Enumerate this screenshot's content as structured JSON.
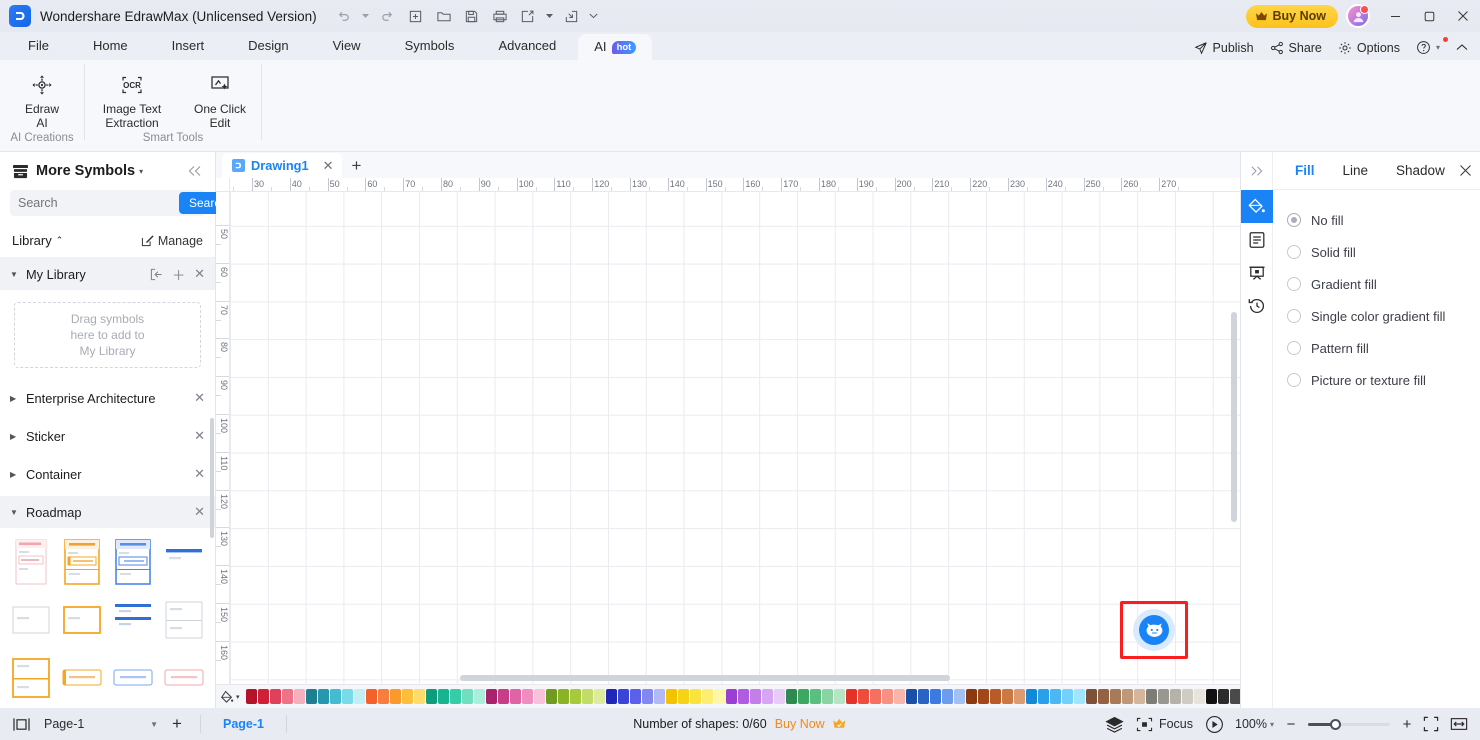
{
  "titlebar": {
    "app_title": "Wondershare EdrawMax (Unlicensed Version)",
    "logo_glyph": "Ɔ",
    "quick_access": [
      {
        "name": "undo-button",
        "glyph": "↶"
      },
      {
        "name": "undo-dropdown",
        "glyph": "▾"
      },
      {
        "name": "redo-button",
        "glyph": "↷"
      },
      {
        "name": "new-button",
        "glyph": "＋"
      },
      {
        "name": "open-button",
        "glyph": "🗀"
      },
      {
        "name": "save-button",
        "glyph": "🖫"
      },
      {
        "name": "print-button",
        "glyph": "🖨"
      },
      {
        "name": "export-button",
        "glyph": "↗"
      },
      {
        "name": "export-dropdown",
        "glyph": "▾"
      },
      {
        "name": "share-quick-button",
        "glyph": "⤵"
      },
      {
        "name": "qat-more-button",
        "glyph": "⌄"
      }
    ],
    "buy_now": "Buy Now",
    "window_controls": [
      {
        "name": "minimize-button",
        "glyph": "—"
      },
      {
        "name": "maximize-button",
        "glyph": "☐"
      },
      {
        "name": "close-button",
        "glyph": "✕"
      }
    ]
  },
  "menubar": {
    "items": [
      {
        "label": "File",
        "name": "menu-file"
      },
      {
        "label": "Home",
        "name": "menu-home"
      },
      {
        "label": "Insert",
        "name": "menu-insert"
      },
      {
        "label": "Design",
        "name": "menu-design"
      },
      {
        "label": "View",
        "name": "menu-view"
      },
      {
        "label": "Symbols",
        "name": "menu-symbols"
      },
      {
        "label": "Advanced",
        "name": "menu-advanced"
      }
    ],
    "active_tab": {
      "label": "AI",
      "badge": "hot"
    },
    "right_items": [
      {
        "label": "Publish",
        "name": "publish-button"
      },
      {
        "label": "Share",
        "name": "share-button"
      },
      {
        "label": "Options",
        "name": "options-button"
      }
    ],
    "help_glyph": "?",
    "collapse_glyph": "⌃"
  },
  "ribbon": {
    "groups": [
      {
        "label": "AI Creations",
        "name": "ribbon-group-ai-creations",
        "buttons": [
          {
            "label": "Edraw\nAI",
            "line1": "Edraw",
            "line2": "AI",
            "name": "edraw-ai-button",
            "icon": "ai-move-icon"
          }
        ]
      },
      {
        "label": "Smart Tools",
        "name": "ribbon-group-smart-tools",
        "buttons": [
          {
            "line1": "Image Text",
            "line2": "Extraction",
            "name": "image-text-extraction-button",
            "icon": "ocr-icon"
          },
          {
            "line1": "One Click",
            "line2": "Edit",
            "name": "one-click-edit-button",
            "icon": "magic-edit-icon"
          }
        ]
      }
    ]
  },
  "left_panel": {
    "title": "More Symbols",
    "search": {
      "placeholder": "Search",
      "value": "",
      "button_label": "Search"
    },
    "library_label": "Library",
    "manage_label": "Manage",
    "sections": [
      {
        "label": "My Library",
        "name": "library-section-my-library",
        "expanded": true
      },
      {
        "label": "Enterprise Architecture",
        "name": "library-section-enterprise-architecture",
        "expanded": false
      },
      {
        "label": "Sticker",
        "name": "library-section-sticker",
        "expanded": false
      },
      {
        "label": "Container",
        "name": "library-section-container",
        "expanded": false
      },
      {
        "label": "Roadmap",
        "name": "library-section-roadmap",
        "expanded": true
      }
    ],
    "my_library_placeholder": "Drag symbols\nhere to add to\nMy Library",
    "my_library_placeholder_lines": [
      "Drag symbols",
      "here to add to",
      "My Library"
    ]
  },
  "canvas": {
    "tab": {
      "label": "Drawing1",
      "name": "document-tab-drawing1"
    },
    "add_tab_glyph": "+",
    "ruler_h_labels": [
      "30",
      "40",
      "50",
      "60",
      "70",
      "80",
      "90",
      "100",
      "110",
      "120",
      "130",
      "140",
      "150",
      "160",
      "170",
      "180",
      "190",
      "200",
      "210",
      "220",
      "230",
      "240",
      "250",
      "260",
      "270"
    ],
    "ruler_v_labels": [
      "50",
      "60",
      "70",
      "80",
      "90",
      "100",
      "110",
      "120",
      "130",
      "140",
      "150",
      "160"
    ],
    "ai_bot": {
      "name": "ai-assistant-bot-icon",
      "highlighted": true
    }
  },
  "palette": {
    "colors": [
      "#b5132a",
      "#cf2038",
      "#e0415a",
      "#ee7389",
      "#f5b0bb",
      "#1e7f92",
      "#2698ad",
      "#44bbd0",
      "#7adbe8",
      "#c3eef4",
      "#f2622a",
      "#f87e3e",
      "#fa9a2c",
      "#fdbe3a",
      "#fedb6b",
      "#0f9c7c",
      "#16b58f",
      "#34cda6",
      "#6fdfc0",
      "#abeedc",
      "#a8236b",
      "#c73d87",
      "#e063a5",
      "#ef8dbe",
      "#f8c2da",
      "#6f9c1e",
      "#8ab425",
      "#a7c93c",
      "#c2dc66",
      "#ddeb9e",
      "#2027b8",
      "#3a44d6",
      "#5a61e8",
      "#8189f0",
      "#b3b8f7",
      "#f4c300",
      "#f7d317",
      "#fbe33e",
      "#fdee71",
      "#fef6a8",
      "#9a3fd2",
      "#b05ce0",
      "#c47eea",
      "#d7a5f1",
      "#e8cbf7",
      "#2e8a4e",
      "#3da862",
      "#5cbf80",
      "#8ad3a3",
      "#b6e5c6",
      "#e53228",
      "#ef4d3c",
      "#f4705f",
      "#f79183",
      "#fab5ab",
      "#1a4fa8",
      "#2a63c4",
      "#3c7ae0",
      "#6d9cec",
      "#a3c0f3",
      "#8b3a10",
      "#a24717",
      "#b85b26",
      "#cc7843",
      "#dd9b6f",
      "#1189d6",
      "#2aa0ea",
      "#4bb8f4",
      "#72d1fa",
      "#9fe5fd",
      "#7d5038",
      "#946243",
      "#a87a58",
      "#bf9878",
      "#d4b69c",
      "#7d7c76",
      "#999890",
      "#b5b3a9",
      "#cfcdc3",
      "#e6e4dc",
      "#111111",
      "#2c2c2c",
      "#4a4a4a",
      "#6b6b6b",
      "#8d8d8d",
      "#a9a9a9",
      "#c4c4c4",
      "#dedede",
      "#efefef",
      "#f8f8f8"
    ]
  },
  "right_panel": {
    "rail": [
      {
        "name": "fill-rail-icon",
        "active": true
      },
      {
        "name": "document-rail-icon",
        "active": false
      },
      {
        "name": "presentation-rail-icon",
        "active": false
      },
      {
        "name": "history-rail-icon",
        "active": false
      }
    ],
    "tabs": [
      {
        "label": "Fill",
        "name": "tab-fill",
        "active": true
      },
      {
        "label": "Line",
        "name": "tab-line",
        "active": false
      },
      {
        "label": "Shadow",
        "name": "tab-shadow",
        "active": false
      }
    ],
    "close_glyph": "✕",
    "collapse_glyph": "»",
    "fill_options": [
      {
        "label": "No fill",
        "name": "radio-no-fill",
        "checked": true
      },
      {
        "label": "Solid fill",
        "name": "radio-solid-fill",
        "checked": false
      },
      {
        "label": "Gradient fill",
        "name": "radio-gradient-fill",
        "checked": false
      },
      {
        "label": "Single color gradient fill",
        "name": "radio-single-color-gradient-fill",
        "checked": false
      },
      {
        "label": "Pattern fill",
        "name": "radio-pattern-fill",
        "checked": false
      },
      {
        "label": "Picture or texture fill",
        "name": "radio-picture-or-texture-fill",
        "checked": false
      }
    ]
  },
  "statusbar": {
    "page_select_value": "Page-1",
    "add_page_glyph": "+",
    "page_tab_label": "Page-1",
    "shapes_text": "Number of shapes: 0/60",
    "buy_now_label": "Buy Now",
    "focus_label": "Focus",
    "zoom_value": "100%",
    "zoom_minus": "−",
    "zoom_plus": "+"
  }
}
